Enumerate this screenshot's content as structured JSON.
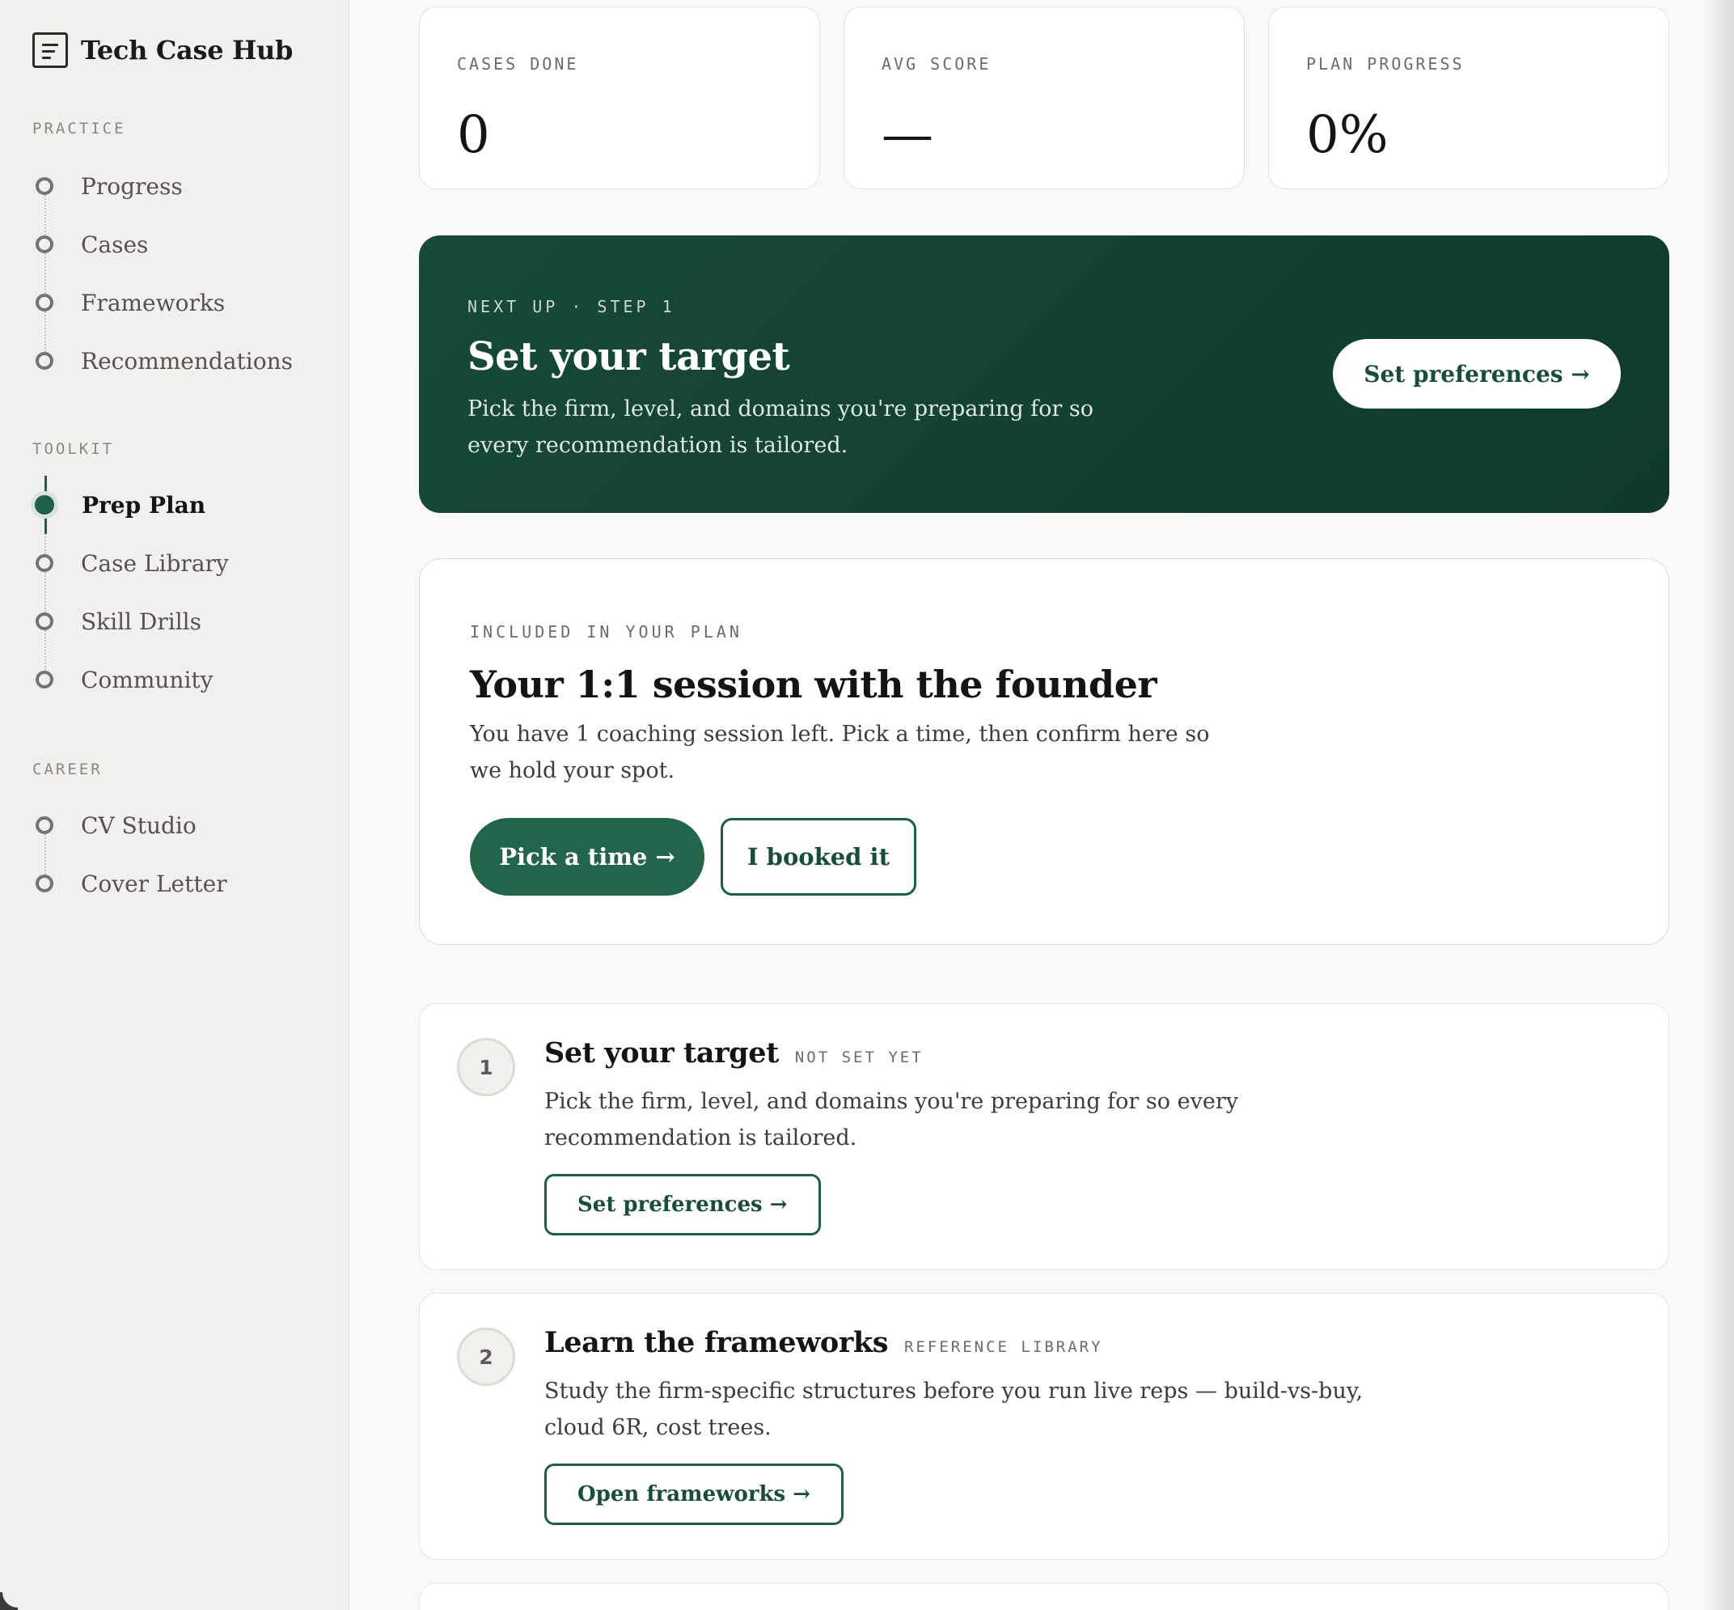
{
  "sidebar": {
    "brand": "Tech Case Hub",
    "sections": [
      {
        "title": "PRACTICE",
        "items": [
          {
            "label": "Progress"
          },
          {
            "label": "Cases"
          },
          {
            "label": "Frameworks"
          },
          {
            "label": "Recommendations"
          }
        ]
      },
      {
        "title": "TOOLKIT",
        "items": [
          {
            "label": "Prep Plan",
            "active": true
          },
          {
            "label": "Case Library"
          },
          {
            "label": "Skill Drills"
          },
          {
            "label": "Community"
          }
        ]
      },
      {
        "title": "CAREER",
        "items": [
          {
            "label": "CV Studio"
          },
          {
            "label": "Cover Letter"
          }
        ]
      }
    ]
  },
  "stats": [
    {
      "label": "CASES DONE",
      "value": "0"
    },
    {
      "label": "AVG SCORE",
      "value": "—"
    },
    {
      "label": "PLAN PROGRESS",
      "value": "0%"
    }
  ],
  "hero": {
    "eyebrow": "NEXT UP · STEP 1",
    "title": "Set your target",
    "description": "Pick the firm, level, and domains you're preparing for so every recommendation is tailored.",
    "button": "Set preferences →"
  },
  "session": {
    "eyebrow": "INCLUDED IN YOUR PLAN",
    "title": "Your 1:1 session with the founder",
    "description": "You have 1 coaching session left. Pick a time, then confirm here so we hold your spot.",
    "primary_button": "Pick a time →",
    "secondary_button": "I booked it"
  },
  "steps": [
    {
      "number": "1",
      "title": "Set your target",
      "tag": "NOT SET YET",
      "description": "Pick the firm, level, and domains you're preparing for so every recommendation is tailored.",
      "button": "Set preferences →"
    },
    {
      "number": "2",
      "title": "Learn the frameworks",
      "tag": "REFERENCE LIBRARY",
      "description": "Study the firm-specific structures before you run live reps — build-vs-buy, cloud 6R, cost trees.",
      "button": "Open frameworks →"
    }
  ],
  "colors": {
    "accent": "#1f5f44",
    "hero_bg": "#123f2d",
    "sidebar_bg": "#f2f0ea",
    "page_bg": "#faf9f6"
  }
}
